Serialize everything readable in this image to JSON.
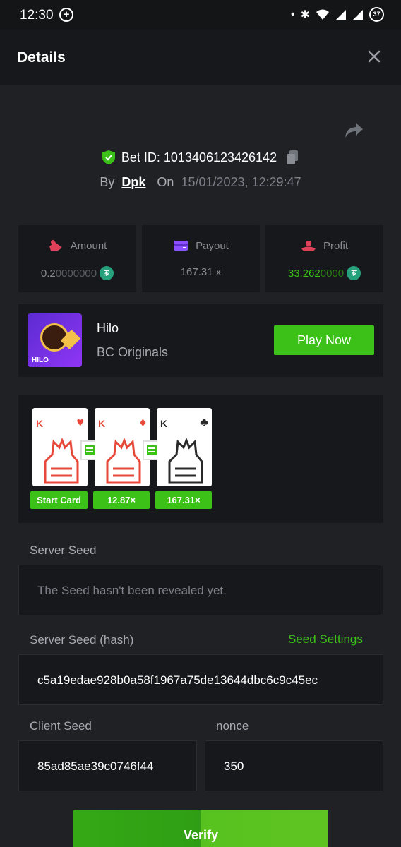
{
  "status_bar": {
    "time": "12:30",
    "battery": "37"
  },
  "header": {
    "title": "Details"
  },
  "bet": {
    "id_label": "Bet ID: 1013406123426142",
    "by_label": "By",
    "user": "Dpk",
    "on_label": "On",
    "date": "15/01/2023, 12:29:47"
  },
  "stats": {
    "amount_label": "Amount",
    "amount_main": "0.2",
    "amount_dim": "0000000",
    "payout_label": "Payout",
    "payout_value": "167.31 x",
    "profit_label": "Profit",
    "profit_main": "33.262",
    "profit_dim": "0000"
  },
  "game": {
    "thumb_label": "HILO",
    "name": "Hilo",
    "provider": "BC Originals",
    "play_label": "Play Now"
  },
  "cards": [
    {
      "rank": "K",
      "suit": "♥",
      "color": "#e8483a",
      "tag": "Start Card"
    },
    {
      "rank": "K",
      "suit": "♦",
      "color": "#e8483a",
      "tag": "12.87×"
    },
    {
      "rank": "K",
      "suit": "♣",
      "color": "#2a2a2a",
      "tag": "167.31×"
    }
  ],
  "seeds": {
    "server_seed_label": "Server Seed",
    "server_seed_value": "The Seed hasn't been revealed yet.",
    "server_hash_label": "Server Seed (hash)",
    "seed_settings_label": "Seed Settings",
    "server_hash_value": "c5a19edae928b0a58f1967a75de13644dbc6c9c45ec",
    "client_seed_label": "Client Seed",
    "client_seed_value": "85ad85ae39c0746f44",
    "nonce_label": "nonce",
    "nonce_value": "350"
  },
  "verify_label": "Verify",
  "colors": {
    "accent": "#3bc117",
    "background": "#1f2125",
    "panel": "#17181b"
  }
}
